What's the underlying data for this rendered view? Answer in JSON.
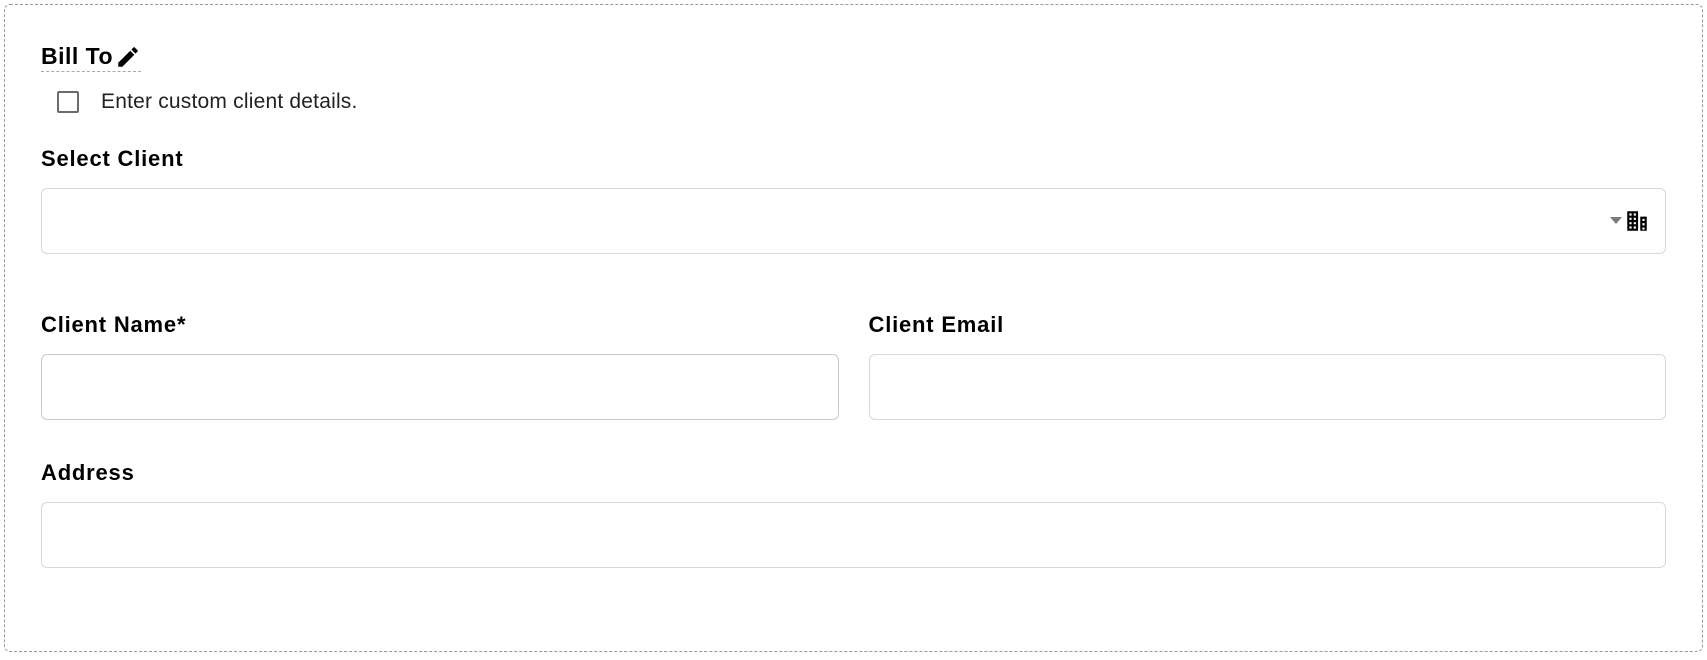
{
  "billTo": {
    "heading": "Bill To",
    "custom_checkbox_label": "Enter custom client details.",
    "custom_checked": false,
    "select_client_label": "Select Client",
    "select_client_value": "",
    "client_name_label": "Client Name",
    "client_name_required_mark": "*",
    "client_name_value": "",
    "client_email_label": "Client Email",
    "client_email_value": "",
    "address_label": "Address",
    "address_value": ""
  }
}
